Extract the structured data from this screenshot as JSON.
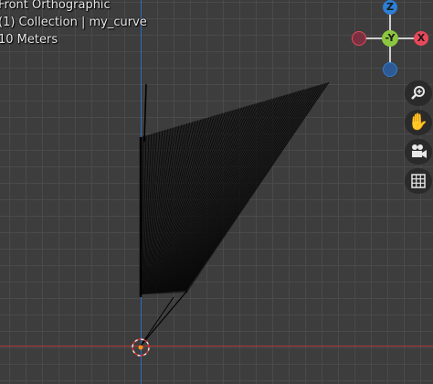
{
  "viewport": {
    "view_name": "Front Orthographic",
    "collection": "(1) Collection | my_curve",
    "grid_scale": "10 Meters"
  },
  "gizmo": {
    "z_label": "Z",
    "y_label": "-Y",
    "x_label": "X",
    "colors": {
      "x": "#e8485a",
      "y": "#8cc63f",
      "z": "#2e7ed6"
    }
  },
  "toolbar": {
    "zoom_icon": "magnifier-plus-icon",
    "pan_icon": "hand-icon",
    "camera_icon": "camera-icon",
    "grid_icon": "grid-icon"
  },
  "colors": {
    "background": "#3d3d3d",
    "x_axis": "#b23a3a",
    "z_axis": "#2b6bc0",
    "origin": "#ff8c1a"
  }
}
